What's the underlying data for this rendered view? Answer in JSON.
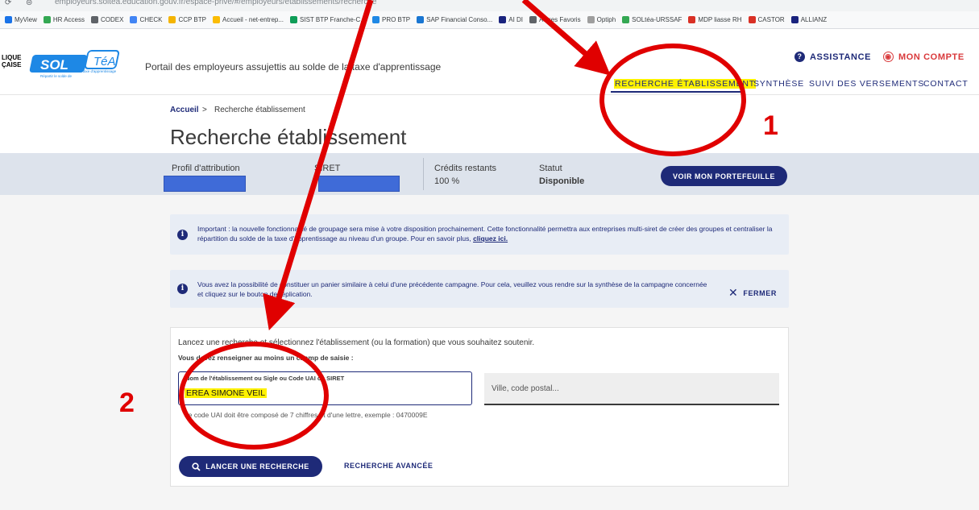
{
  "browser": {
    "url": "employeurs.soltea.education.gouv.fr/espace-prive/#/employeurs/etablissements/recherche",
    "bookmarks": [
      {
        "label": "MyView",
        "color": "#1a73e8"
      },
      {
        "label": "HR Access",
        "color": "#34a853"
      },
      {
        "label": "CODEX",
        "color": "#5f6368"
      },
      {
        "label": "CHECK",
        "color": "#4285f4"
      },
      {
        "label": "CCP BTP",
        "color": "#f4b400"
      },
      {
        "label": "Accueil - net-entrep...",
        "color": "#fbbc04"
      },
      {
        "label": "SIST BTP Franche-C...",
        "color": "#0f9d58"
      },
      {
        "label": "PRO BTP",
        "color": "#1e88e5"
      },
      {
        "label": "SAP Financial Conso...",
        "color": "#1976d2"
      },
      {
        "label": "AI DI",
        "color": "#1a237e"
      },
      {
        "label": "Autres Favoris",
        "color": "#5f6368"
      },
      {
        "label": "Optiph",
        "color": "#9e9e9e"
      },
      {
        "label": "SOLtéa-URSSAF",
        "color": "#34a853"
      },
      {
        "label": "MDP liasse RH",
        "color": "#d93025"
      },
      {
        "label": "CASTOR",
        "color": "#d93025"
      },
      {
        "label": "ALLIANZ",
        "color": "#1a237e"
      }
    ]
  },
  "header": {
    "logo_side_text": "LIQUE\nÇAISE",
    "logo_sol": "SOL",
    "logo_tea": "TéA",
    "logo_caption_1": "Répartir le solde de",
    "logo_caption_2": "la taxe d'apprentissage",
    "tagline": "Portail des employeurs assujettis au solde de la taxe d'apprentissage",
    "assistance": "ASSISTANCE",
    "account": "MON COMPTE",
    "nav": {
      "search": "RECHERCHE ÉTABLISSEMENT",
      "synthesis": "SYNTHÈSE",
      "payments": "SUIVI DES VERSEMENTS",
      "contact": "CONTACT"
    }
  },
  "breadcrumb": {
    "home": "Accueil",
    "sep": ">",
    "current": "Recherche établissement"
  },
  "page_title": "Recherche établissement",
  "profile": {
    "profil_label": "Profil d'attribution",
    "siret_label": "SIRET",
    "credits_label": "Crédits restants",
    "credits_value": "100 %",
    "status_label": "Statut",
    "status_value": "Disponible",
    "portfolio_button": "VOIR MON PORTEFEUILLE"
  },
  "notices": {
    "grouping_text": "Important : la nouvelle fonctionnalité de groupage sera mise à votre disposition prochainement. Cette fonctionnalité permettra aux entreprises multi-siret de créer des groupes et centraliser la répartition du solde de la taxe d'apprentissage au niveau d'un groupe. Pour en savoir plus,",
    "grouping_link": "cliquez ici.",
    "replication_text": "Vous avez la possibilité de constituer un panier similaire à celui d'une précédente campagne. Pour cela, veuillez vous rendre sur la synthèse de la campagne concernée et cliquez sur le bouton de réplication.",
    "close_label": "FERMER"
  },
  "search": {
    "intro": "Lancez une recherche et sélectionnez l'établissement (ou la formation) que vous souhaitez soutenir.",
    "required_note": "Vous devez renseigner au moins un champ de saisie :",
    "name_label": "Nom de l'établissement ou Sigle ou Code UAI ou SIRET",
    "name_value": "EREA SIMONE VEIL",
    "city_placeholder": "Ville, code postal...",
    "hint": "Le code UAI doit être composé de 7 chiffres et d'une lettre, exemple : 0470009E",
    "search_button": "LANCER UNE RECHERCHE",
    "advanced_link": "RECHERCHE AVANCÉE"
  },
  "annotations": {
    "label_1": "1",
    "label_2": "2",
    "color": "#e00000"
  },
  "colors": {
    "primary": "#1e2a78",
    "highlight": "#fff200",
    "redaction": "#3f6bd8",
    "account": "#d9393b"
  }
}
